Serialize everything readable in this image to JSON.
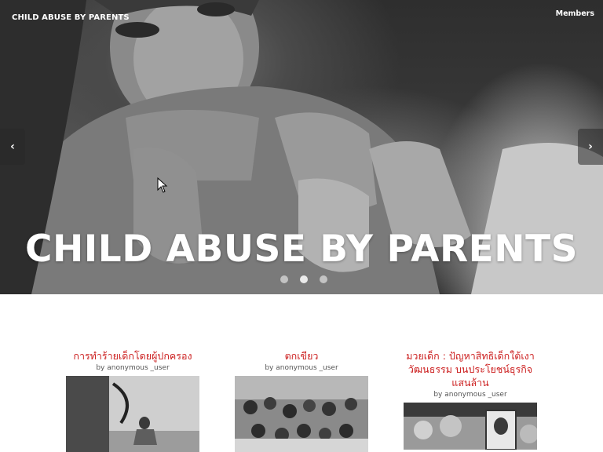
{
  "header": {
    "site_title": "CHILD ABUSE BY PARENTS",
    "members_label": "Members"
  },
  "hero": {
    "headline": "CHILD ABUSE BY PARENTS",
    "prev_label": "‹",
    "next_label": "›",
    "slides": 3,
    "active_slide": 1
  },
  "posts": [
    {
      "title": "การทำร้ายเด็กโดยผู้ปกครอง",
      "byline": "by anonymous _user"
    },
    {
      "title": "ตกเขียว",
      "byline": "by anonymous _user"
    },
    {
      "title": "มวยเด็ก : ปัญหาสิทธิเด็กใต้เงาวัฒนธรรม บนประโยชน์ธุรกิจแสนล้าน",
      "byline": "by anonymous _user"
    }
  ],
  "colors": {
    "post_title": "#cc1f1f",
    "hero_text": "#ffffff",
    "background": "#ffffff"
  }
}
